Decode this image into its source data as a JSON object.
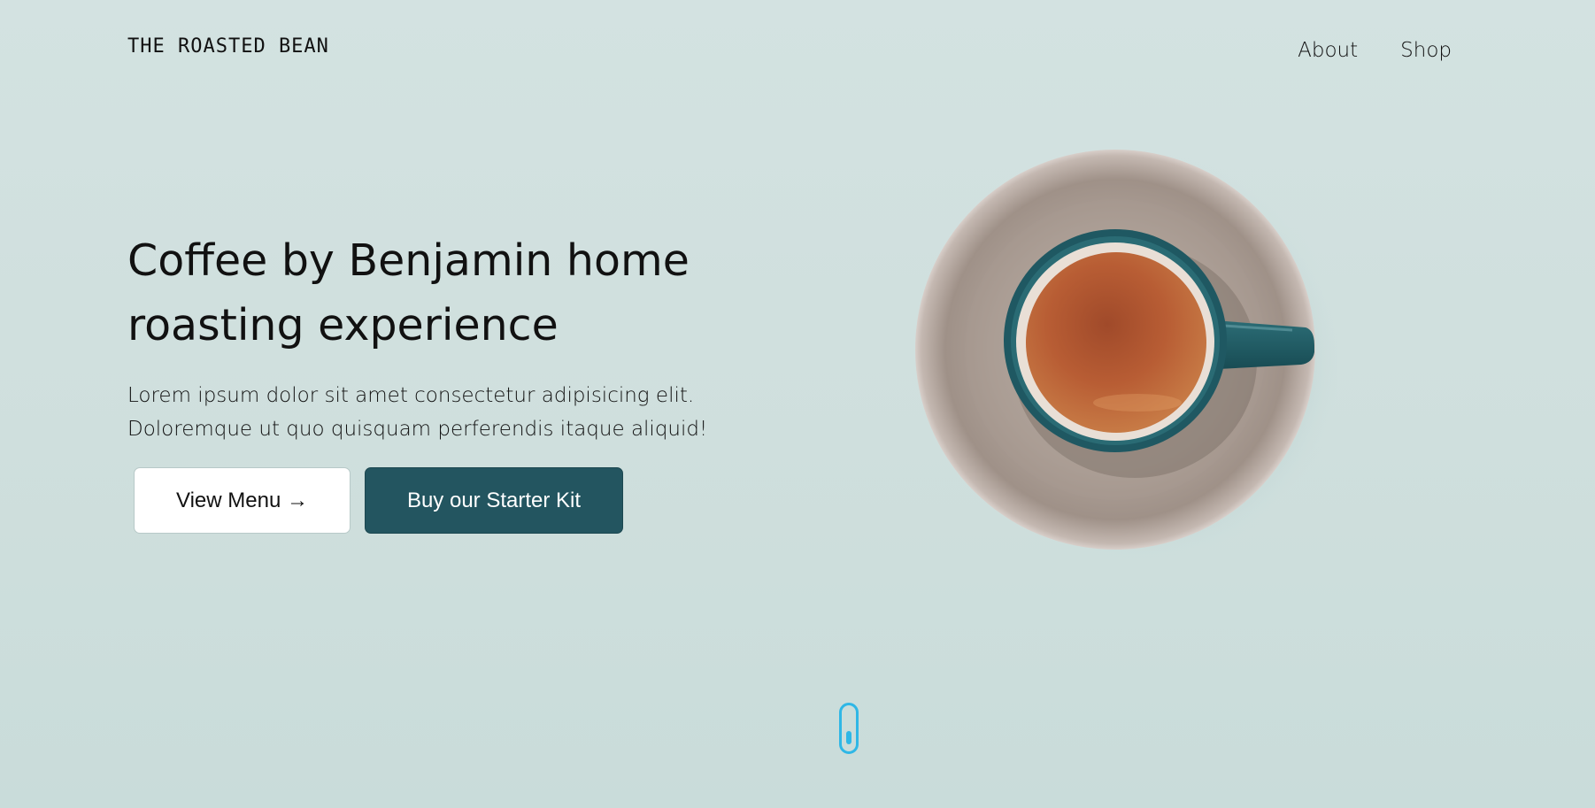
{
  "header": {
    "logo": "THE ROASTED BEAN",
    "nav": [
      {
        "label": "About"
      },
      {
        "label": "Shop"
      }
    ]
  },
  "hero": {
    "title_line1": "Coffee by Benjamin home",
    "title_line2": "roasting experience",
    "text_line1": "Lorem ipsum dolor sit amet consectetur adipisicing elit.",
    "text_line2": "Doloremque ut quo quisquam perferendis itaque aliquid!",
    "primary_button": "View Menu →",
    "secondary_button": "Buy our Starter Kit"
  },
  "icons": {
    "hero_image": "coffee-cup-on-saucer",
    "scroll": "mouse-scroll-icon"
  },
  "colors": {
    "background": "#d3e2e1",
    "accent": "#235560",
    "scroll_indicator": "#2fb7e6"
  }
}
